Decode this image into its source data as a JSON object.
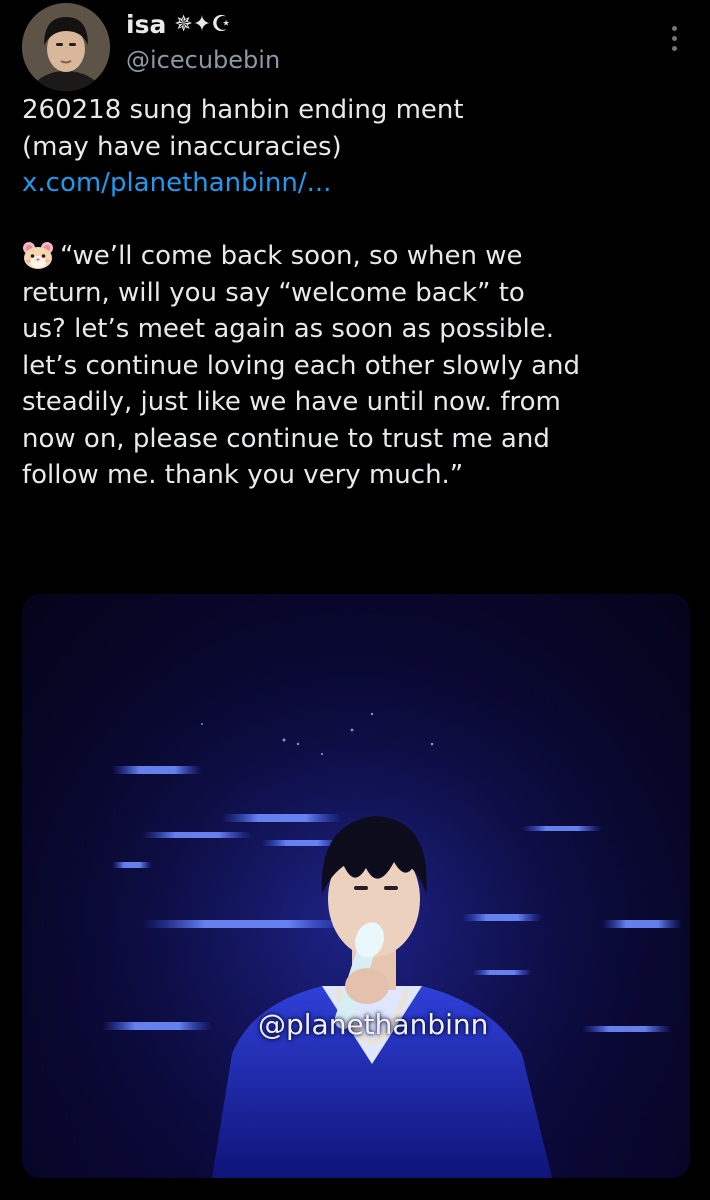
{
  "author": {
    "display_name": "isa",
    "name_decoration": "✵✦☪",
    "handle": "@icecubebin"
  },
  "tweet": {
    "lines": [
      "260218 sung hanbin ending ment",
      "(may have inaccuracies)"
    ],
    "link": "x.com/planethanbinn/...",
    "quote_emoji_icon": "hamster-face-icon",
    "quote_lines": [
      "“we’ll come back soon, so when we",
      "return, will you say “welcome back” to",
      "us? let’s meet again as soon as possible.",
      "let’s continue loving each other slowly and",
      "steadily, just like we have until now. from",
      "now on, please continue to trust me and",
      "follow me. thank you very much.”"
    ]
  },
  "media": {
    "watermark": "@planethanbinn"
  },
  "colors": {
    "background": "#000000",
    "text": "#e7e9ea",
    "muted": "#8b98a5",
    "link": "#1d9bf0",
    "stage_blue": "#1a2fd0"
  }
}
